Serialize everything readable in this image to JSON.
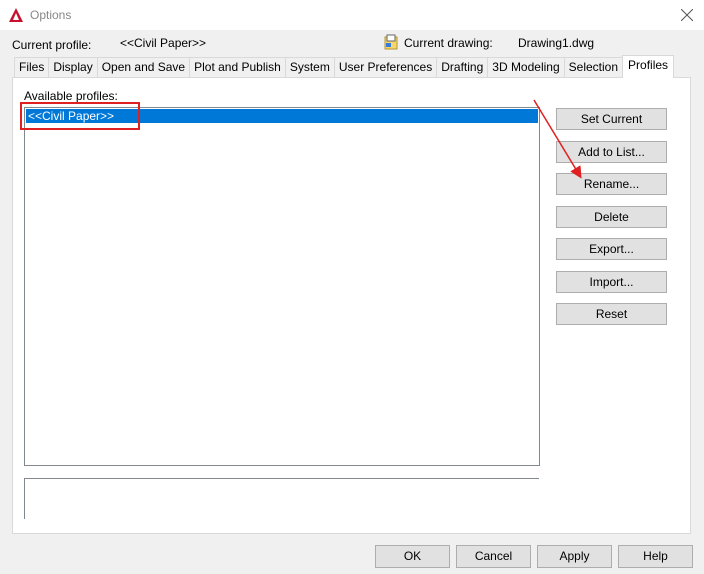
{
  "window": {
    "title": "Options",
    "close_icon": "close-icon"
  },
  "header": {
    "current_profile_label": "Current profile:",
    "current_profile_value": "<<Civil Paper>>",
    "current_drawing_label": "Current drawing:",
    "current_drawing_value": "Drawing1.dwg"
  },
  "tabs": [
    "Files",
    "Display",
    "Open and Save",
    "Plot and Publish",
    "System",
    "User Preferences",
    "Drafting",
    "3D Modeling",
    "Selection",
    "Profiles"
  ],
  "active_tab": "Profiles",
  "profiles": {
    "label": "Available profiles:",
    "items": [
      "<<Civil Paper>>"
    ],
    "selected": "<<Civil Paper>>"
  },
  "buttons": {
    "set_current": "Set Current",
    "add_to_list": "Add to List...",
    "rename": "Rename...",
    "delete": "Delete",
    "export": "Export...",
    "import": "Import...",
    "reset": "Reset"
  },
  "footer": {
    "ok": "OK",
    "cancel": "Cancel",
    "apply": "Apply",
    "help": "Help"
  },
  "colors": {
    "selection": "#0078d7",
    "annotation": "#e02020",
    "app_icon": "#c8102e"
  }
}
